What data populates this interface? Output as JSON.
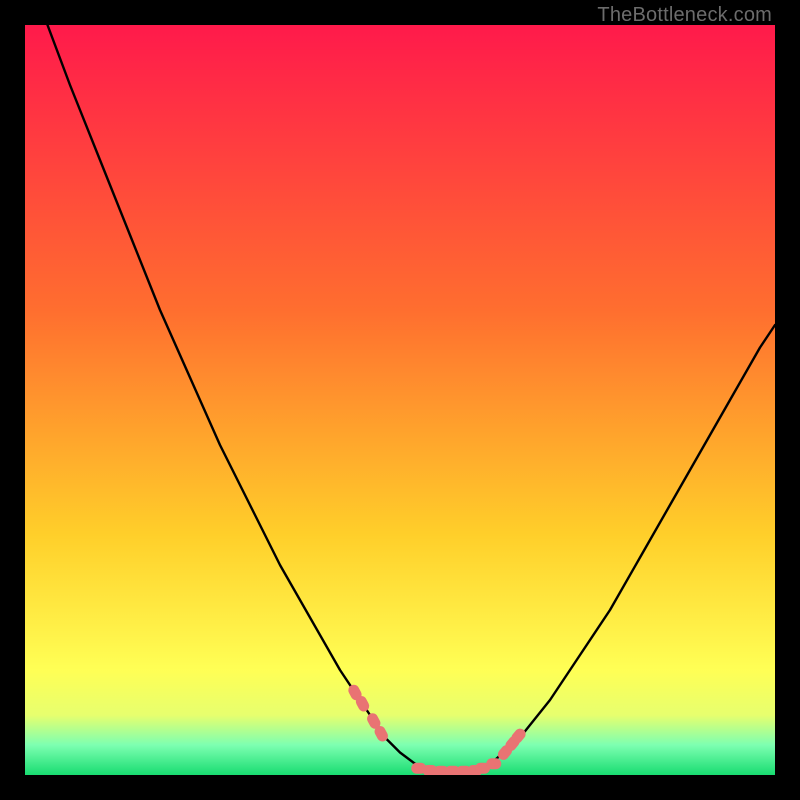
{
  "watermark": "TheBottleneck.com",
  "colors": {
    "frame": "#000000",
    "gradient_top": "#ff1a4b",
    "gradient_mid1": "#ff8a2a",
    "gradient_mid2": "#ffe131",
    "gradient_low": "#f7ff66",
    "gradient_green": "#27e27a",
    "curve": "#000000",
    "marker": "#e97373"
  },
  "chart_data": {
    "type": "line",
    "title": "",
    "xlabel": "",
    "ylabel": "",
    "xlim": [
      0,
      100
    ],
    "ylim": [
      0,
      100
    ],
    "series": [
      {
        "name": "bottleneck-curve",
        "x": [
          3,
          6,
          10,
          14,
          18,
          22,
          26,
          30,
          34,
          38,
          42,
          44,
          46,
          48,
          50,
          52,
          54,
          56,
          58,
          60,
          62,
          66,
          70,
          74,
          78,
          82,
          86,
          90,
          94,
          98,
          100
        ],
        "y": [
          100,
          92,
          82,
          72,
          62,
          53,
          44,
          36,
          28,
          21,
          14,
          11,
          8,
          5,
          3,
          1.5,
          0.7,
          0.5,
          0.5,
          0.6,
          1.4,
          5,
          10,
          16,
          22,
          29,
          36,
          43,
          50,
          57,
          60
        ]
      }
    ],
    "flat_region_x": [
      53,
      61
    ],
    "marker_clusters": [
      {
        "name": "left-slope-markers",
        "points": [
          [
            44,
            11
          ],
          [
            45,
            9.5
          ],
          [
            46.5,
            7.2
          ],
          [
            47.5,
            5.5
          ]
        ]
      },
      {
        "name": "flat-bottom-markers",
        "points": [
          [
            52.5,
            0.9
          ],
          [
            54,
            0.6
          ],
          [
            55.5,
            0.5
          ],
          [
            57,
            0.5
          ],
          [
            58.5,
            0.5
          ],
          [
            60,
            0.6
          ],
          [
            61,
            0.9
          ],
          [
            62.5,
            1.5
          ]
        ]
      },
      {
        "name": "right-slope-markers",
        "points": [
          [
            64,
            3.0
          ],
          [
            65,
            4.2
          ],
          [
            65.8,
            5.2
          ]
        ]
      }
    ],
    "gradient_stops_pct": [
      0,
      38,
      68,
      86,
      92,
      96,
      100
    ],
    "gradient_colors": [
      "#ff1a4b",
      "#ff6e2f",
      "#ffcf2a",
      "#ffff55",
      "#e7ff6e",
      "#7dffb1",
      "#18dc71"
    ]
  }
}
